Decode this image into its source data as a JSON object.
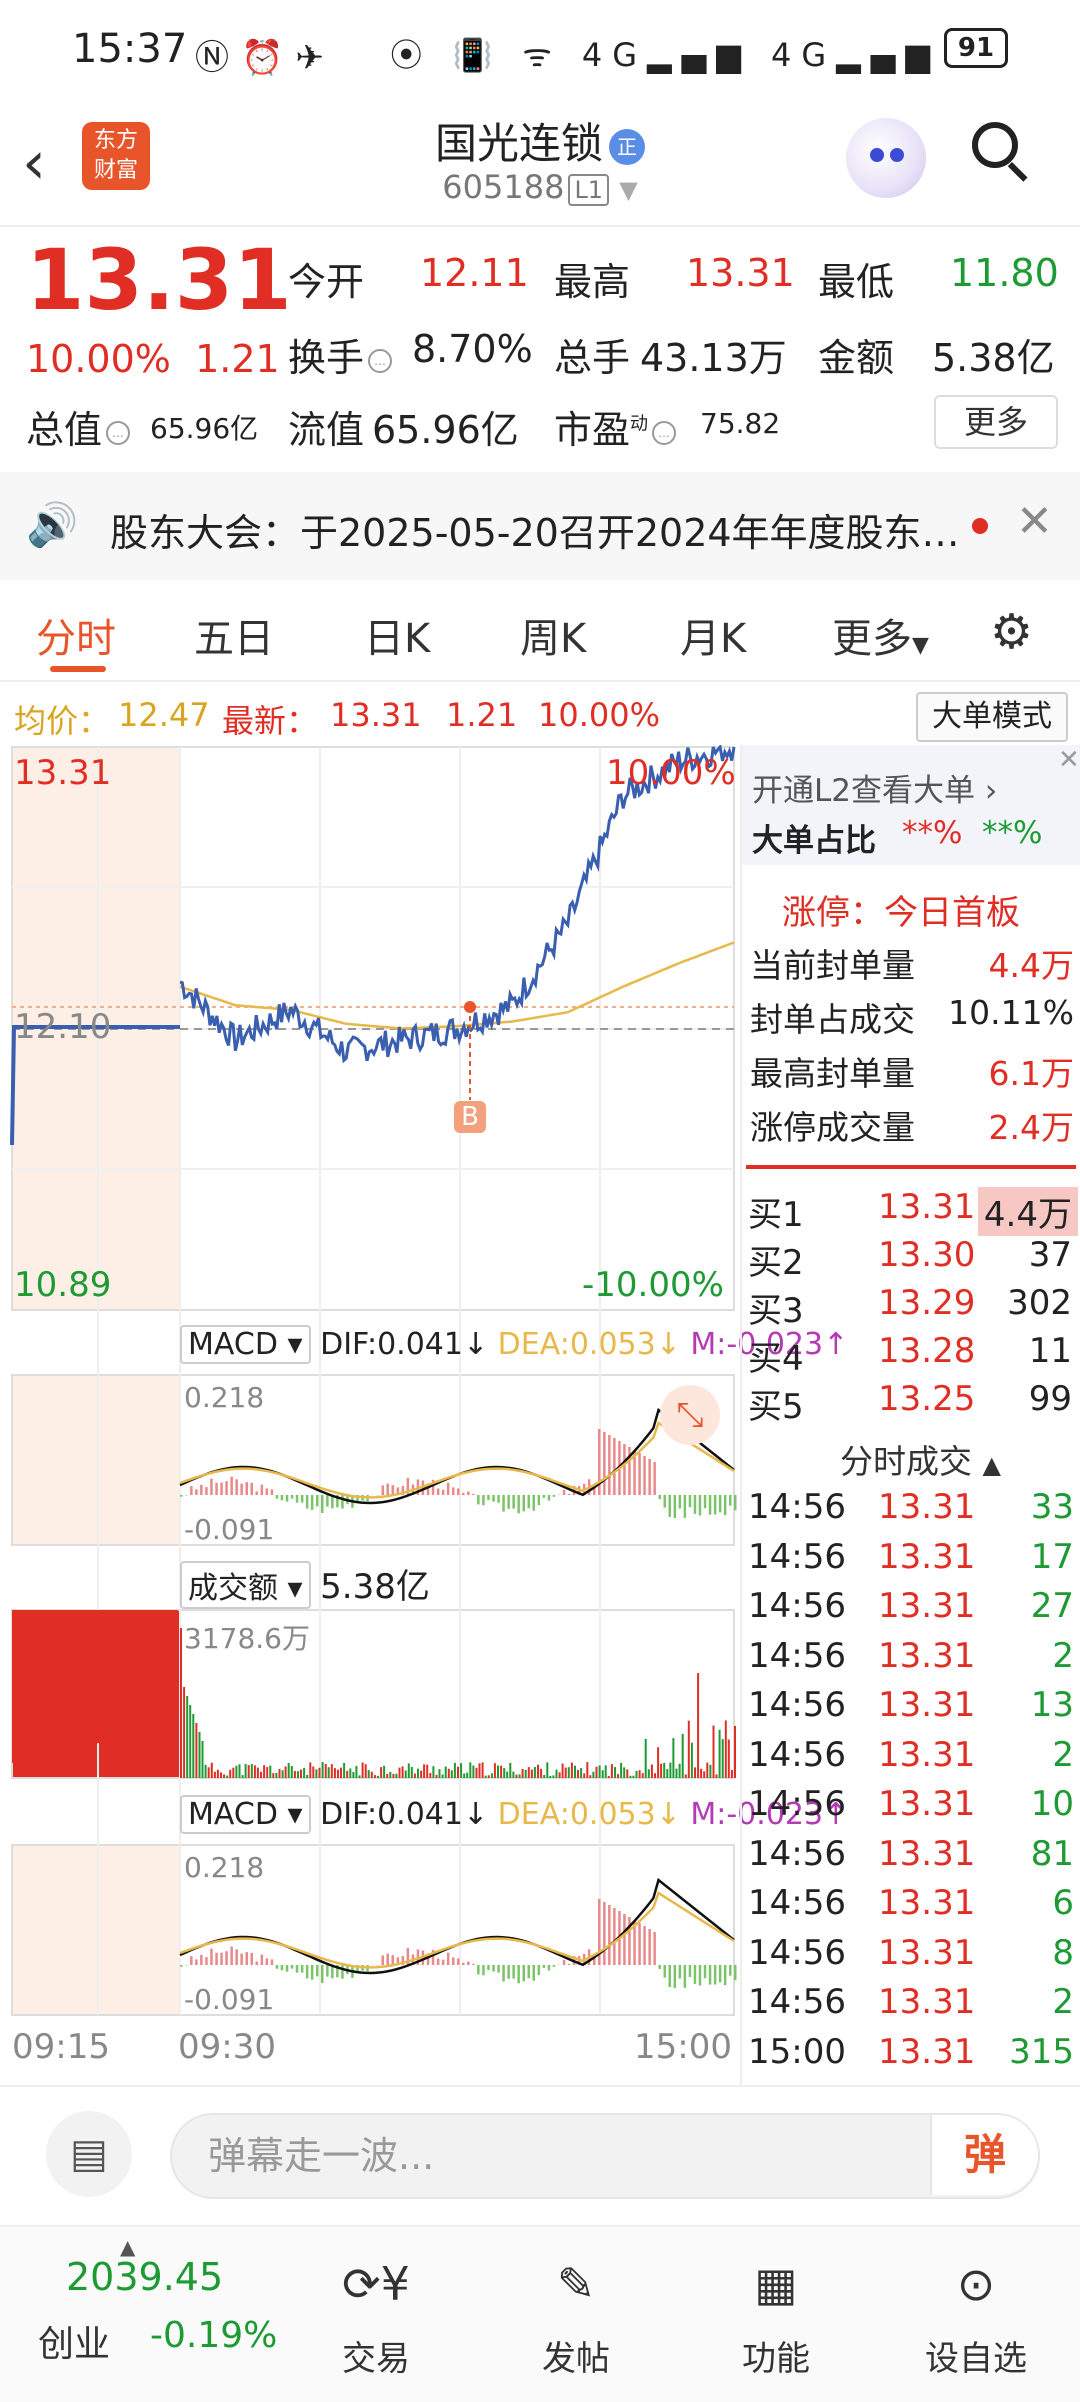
{
  "status_bar": {
    "time": "15:37",
    "network_4g_1": "4G",
    "network_4g_2": "4G",
    "battery": "91"
  },
  "header": {
    "title": "国光连锁",
    "title_badge": "正",
    "code": "605188",
    "level": "L1",
    "logo_line1": "东方",
    "logo_line2": "财富"
  },
  "quote": {
    "price": "13.31",
    "change_pct": "10.00%",
    "change_amt": "1.21",
    "open_label": "今开",
    "open": "12.11",
    "high_label": "最高",
    "high": "13.31",
    "low_label": "最低",
    "low": "11.80",
    "turnover_label": "换手",
    "turnover": "8.70%",
    "volume_label": "总手",
    "volume": "43.13万",
    "amount_label": "金额",
    "amount": "5.38亿",
    "mktcap_label": "总值",
    "mktcap": "65.96亿",
    "float_label": "流值",
    "float": "65.96亿",
    "pe_label": "市盈",
    "pe_sup": "动",
    "pe": "75.82",
    "more": "更多"
  },
  "notice": {
    "text": "股东大会：于2025-05-20召开2024年年度股东…"
  },
  "tabs": [
    "分时",
    "五日",
    "日K",
    "周K",
    "月K",
    "更多"
  ],
  "avg_line": {
    "avg_label": "均价：",
    "avg": "12.47",
    "latest_label": "最新：",
    "latest": "13.31",
    "chg": "1.21",
    "pct": "10.00%",
    "mode_button": "大单模式"
  },
  "chart": {
    "top_price": "13.31",
    "top_pct": "10.00%",
    "mid_price": "12.10",
    "bottom_price": "10.89",
    "bottom_pct": "-10.00%",
    "b_marker": "B",
    "macd": {
      "name": "MACD",
      "dif": "DIF:0.041",
      "dea": "DEA:0.053",
      "m": "M:-0.023",
      "max": "0.218",
      "min": "-0.091"
    },
    "amount_panel": {
      "name": "成交额",
      "value": "5.38亿",
      "max": "3178.6万"
    },
    "time_start": "09:15",
    "time_open": "09:30",
    "time_end": "15:00"
  },
  "chart_data": {
    "type": "line",
    "x": [
      "09:30",
      "10:00",
      "10:30",
      "11:00",
      "11:30",
      "13:00",
      "13:30",
      "14:00",
      "14:30",
      "14:56",
      "15:00"
    ],
    "series": [
      {
        "values": [
          12.3,
          12.05,
          12.18,
          12.0,
          12.05,
          12.1,
          12.2,
          12.55,
          13.1,
          13.25,
          13.31
        ]
      },
      {
        "values": [
          12.28,
          12.2,
          12.18,
          12.12,
          12.1,
          12.11,
          12.13,
          12.17,
          12.28,
          12.38,
          12.47
        ]
      }
    ],
    "ylim": [
      10.89,
      13.31
    ]
  },
  "right_panel": {
    "l2_promo": "开通L2查看大单",
    "big_ratio_label": "大单占比",
    "big_ratio_a": "**%",
    "big_ratio_b": "**%",
    "limit_up_title": "涨停：今日首板",
    "stats": [
      {
        "label": "当前封单量",
        "value": "4.4万"
      },
      {
        "label": "封单占成交",
        "value": "10.11%"
      },
      {
        "label": "最高封单量",
        "value": "6.1万"
      },
      {
        "label": "涨停成交量",
        "value": "2.4万"
      }
    ],
    "bids": [
      {
        "label": "买1",
        "price": "13.31",
        "vol": "4.4万"
      },
      {
        "label": "买2",
        "price": "13.30",
        "vol": "37"
      },
      {
        "label": "买3",
        "price": "13.29",
        "vol": "302"
      },
      {
        "label": "买4",
        "price": "13.28",
        "vol": "11"
      },
      {
        "label": "买5",
        "price": "13.25",
        "vol": "99"
      }
    ],
    "ticks_title": "分时成交",
    "ticks": [
      {
        "time": "14:56",
        "price": "13.31",
        "vol": "33"
      },
      {
        "time": "14:56",
        "price": "13.31",
        "vol": "17"
      },
      {
        "time": "14:56",
        "price": "13.31",
        "vol": "27"
      },
      {
        "time": "14:56",
        "price": "13.31",
        "vol": "2"
      },
      {
        "time": "14:56",
        "price": "13.31",
        "vol": "13"
      },
      {
        "time": "14:56",
        "price": "13.31",
        "vol": "2"
      },
      {
        "time": "14:56",
        "price": "13.31",
        "vol": "10"
      },
      {
        "time": "14:56",
        "price": "13.31",
        "vol": "81"
      },
      {
        "time": "14:56",
        "price": "13.31",
        "vol": "6"
      },
      {
        "time": "14:56",
        "price": "13.31",
        "vol": "8"
      },
      {
        "time": "14:56",
        "price": "13.31",
        "vol": "2"
      },
      {
        "time": "15:00",
        "price": "13.31",
        "vol": "315"
      }
    ]
  },
  "comment": {
    "placeholder": "弹幕走一波...",
    "send": "弹"
  },
  "bottom_nav": {
    "index_value": "2039.45",
    "index_name": "创业",
    "index_change": "-0.19%",
    "items": [
      "交易",
      "发帖",
      "功能",
      "设自选"
    ]
  },
  "colors": {
    "up": "#e02e24",
    "down": "#1d9a33",
    "accent": "#e9552b",
    "price_line": "#3a5fb0",
    "avg_line": "#e8b84a"
  }
}
